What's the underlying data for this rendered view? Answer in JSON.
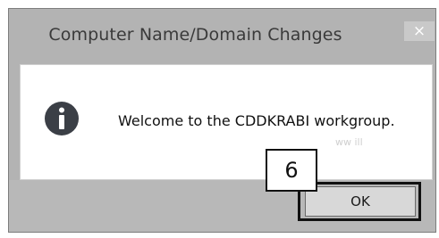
{
  "dialog": {
    "title": "Computer Name/Domain Changes",
    "close_glyph": "×",
    "message": "Welcome to the CDDKRABI workgroup.",
    "faint_text": "ww ill",
    "ok_label": "OK"
  },
  "annotation": {
    "callout_number": "6"
  },
  "icons": {
    "info": "info-icon",
    "close": "close-icon"
  },
  "colors": {
    "frame": "#b3b3b3",
    "info_icon": "#3b3f46"
  }
}
